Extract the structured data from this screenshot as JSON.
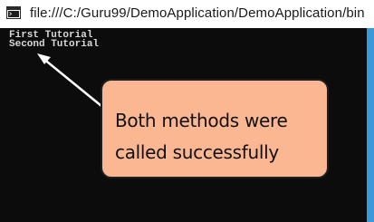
{
  "window": {
    "title": "file:///C:/Guru99/DemoApplication/DemoApplication/bin"
  },
  "console": {
    "lines": [
      "First Tutorial",
      "Second Tutorial"
    ]
  },
  "annotation": {
    "text": "Both methods were called successfully"
  },
  "icons": {
    "app": "console-app-icon"
  },
  "colors": {
    "console_bg": "#0c0c0c",
    "console_text": "#d9d9d9",
    "callout_fill": "#fbb692",
    "window_border": "#3a9ad9"
  }
}
